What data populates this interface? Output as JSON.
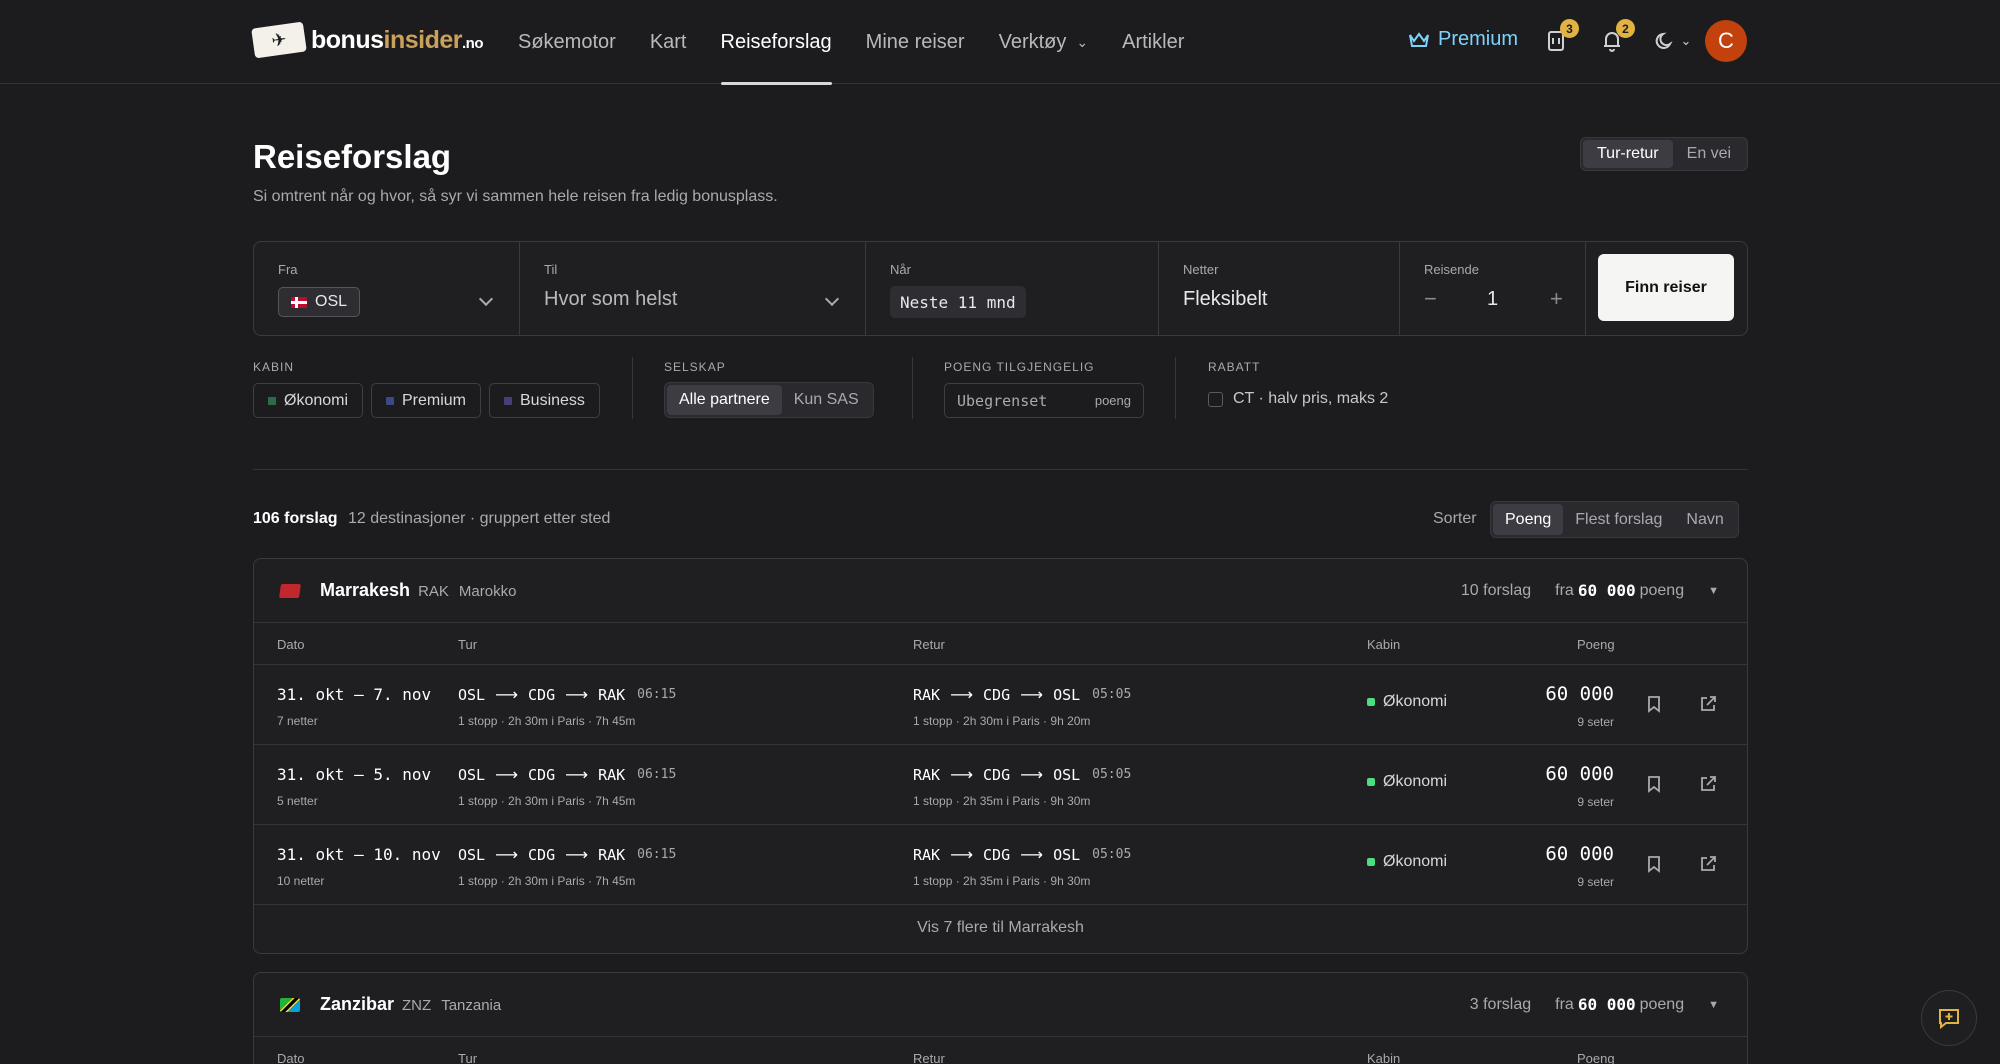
{
  "brand": {
    "name_main": "bonus",
    "name_accent": "insider",
    "tld": ".no"
  },
  "nav": [
    {
      "label": "Søkemotor",
      "active": false
    },
    {
      "label": "Kart",
      "active": false
    },
    {
      "label": "Reiseforslag",
      "active": true
    },
    {
      "label": "Mine reiser",
      "active": false
    },
    {
      "label": "Verktøy",
      "active": false,
      "dropdown": true
    },
    {
      "label": "Artikler",
      "active": false
    }
  ],
  "header": {
    "premium_label": "Premium",
    "ticket_badge": "3",
    "bell_badge": "2",
    "avatar_initial": "C"
  },
  "page": {
    "title": "Reiseforslag",
    "subtitle": "Si omtrent når og hvor, så syr vi sammen hele reisen fra ledig bonusplass.",
    "trip_type": {
      "options": [
        "Tur-retur",
        "En vei"
      ],
      "selected": "Tur-retur"
    }
  },
  "search": {
    "from_label": "Fra",
    "from_value": "OSL",
    "to_label": "Til",
    "to_value": "Hvor som helst",
    "when_label": "Når",
    "when_value": "Neste 11 mnd",
    "nights_label": "Netter",
    "nights_value": "Fleksibelt",
    "travelers_label": "Reisende",
    "travelers_value": "1",
    "minus": "−",
    "plus": "+",
    "submit_label": "Finn reiser"
  },
  "filters": {
    "cabin_label": "KABIN",
    "cabins": [
      {
        "label": "Økonomi",
        "color": "#2f6b47"
      },
      {
        "label": "Premium",
        "color": "#3b4a86"
      },
      {
        "label": "Business",
        "color": "#4a3e7a"
      }
    ],
    "company_label": "SELSKAP",
    "company_options": [
      "Alle partnere",
      "Kun SAS"
    ],
    "company_selected": "Alle partnere",
    "points_label": "POENG TILGJENGELIG",
    "points_placeholder": "Ubegrenset",
    "points_unit": "poeng",
    "discount_label": "RABATT",
    "discount_text": "CT  · halv pris, maks 2"
  },
  "results": {
    "count": "106 forslag",
    "summary": "12 destinasjoner · gruppert etter sted",
    "sort_label": "Sorter",
    "sort_options": [
      "Poeng",
      "Flest forslag",
      "Navn"
    ],
    "sort_selected": "Poeng",
    "columns": {
      "date": "Dato",
      "out": "Tur",
      "ret": "Retur",
      "cabin": "Kabin",
      "points": "Poeng"
    }
  },
  "groups": [
    {
      "city": "Marrakesh",
      "iata": "RAK",
      "country": "Marokko",
      "count": "10 forslag",
      "from_prefix": "fra",
      "from_points": "60 000",
      "from_suffix": "poeng",
      "rows": [
        {
          "date": "31. okt – 7. nov",
          "nights": "7 netter",
          "out": {
            "a": "OSL",
            "b": "CDG",
            "c": "RAK",
            "time": "06:15",
            "info": "1 stopp · 2h 30m i Paris · 7h 45m"
          },
          "ret": {
            "a": "RAK",
            "b": "CDG",
            "c": "OSL",
            "time": "05:05",
            "info": "1 stopp · 2h 30m i Paris · 9h 20m"
          },
          "cabin": "Økonomi",
          "points": "60 000",
          "seats": "9 seter"
        },
        {
          "date": "31. okt – 5. nov",
          "nights": "5 netter",
          "out": {
            "a": "OSL",
            "b": "CDG",
            "c": "RAK",
            "time": "06:15",
            "info": "1 stopp · 2h 30m i Paris · 7h 45m"
          },
          "ret": {
            "a": "RAK",
            "b": "CDG",
            "c": "OSL",
            "time": "05:05",
            "info": "1 stopp · 2h 35m i Paris · 9h 30m"
          },
          "cabin": "Økonomi",
          "points": "60 000",
          "seats": "9 seter"
        },
        {
          "date": "31. okt – 10. nov",
          "nights": "10 netter",
          "out": {
            "a": "OSL",
            "b": "CDG",
            "c": "RAK",
            "time": "06:15",
            "info": "1 stopp · 2h 30m i Paris · 7h 45m"
          },
          "ret": {
            "a": "RAK",
            "b": "CDG",
            "c": "OSL",
            "time": "05:05",
            "info": "1 stopp · 2h 35m i Paris · 9h 30m"
          },
          "cabin": "Økonomi",
          "points": "60 000",
          "seats": "9 seter"
        }
      ],
      "more_label": "Vis 7 flere til Marrakesh"
    },
    {
      "city": "Zanzibar",
      "iata": "ZNZ",
      "country": "Tanzania",
      "count": "3 forslag",
      "from_prefix": "fra",
      "from_points": "60 000",
      "from_suffix": "poeng"
    }
  ]
}
